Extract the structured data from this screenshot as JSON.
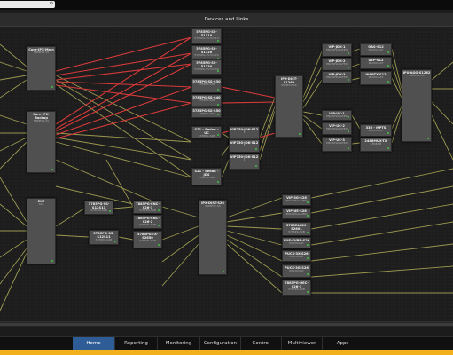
{
  "page_title": "Devices and Links",
  "search": {
    "placeholder": ""
  },
  "colors": {
    "accent": "#2d5c96",
    "link_olive": "#a8a656",
    "link_red": "#d83a3a",
    "status_ok": "#3fbf3f",
    "warning_strip": "#f2b01c"
  },
  "nodes": [
    {
      "id": "core-main",
      "name": "Core-IPX-Main",
      "sub": "SNMPV2-SS"
    },
    {
      "id": "core-backup",
      "name": "Core-IPX-Backup",
      "sub": "SNMPV2-SS"
    },
    {
      "id": "exe",
      "name": "EXE",
      "sub": "S26"
    },
    {
      "id": "s7a",
      "name": "5785PG-SS-51310",
      "sub": "5785PG-SS-51310"
    },
    {
      "id": "s7b",
      "name": "5785PG-SS-51320",
      "sub": "5785PG-SS-51320"
    },
    {
      "id": "s7c",
      "name": "5785PG-SS-51330",
      "sub": "5785PG-SS-51330"
    },
    {
      "id": "s7d",
      "name": "5785PG-SS-S30",
      "sub": "5785PG-S30"
    },
    {
      "id": "s7e",
      "name": "5785PG-SS-S40",
      "sub": "5785PG-S40"
    },
    {
      "id": "s7f",
      "name": "5785PG-SS-S50",
      "sub": "5785PG-S50"
    },
    {
      "id": "s21",
      "name": "S21 - Sedan - UC",
      "sub": "5785PG-S2B"
    },
    {
      "id": "s21b",
      "name": "S21 - Sedan - JDS",
      "sub": "5785PG-S2B"
    },
    {
      "id": "vf1",
      "name": "VIP750-JDK-S12",
      "sub": "3"
    },
    {
      "id": "vf2",
      "name": "VIP750-JDK-S12",
      "sub": "2"
    },
    {
      "id": "vf3",
      "name": "VIP750-JDK-S12",
      "sub": "1"
    },
    {
      "id": "ipx-dist1",
      "name": "IPX-DIST-S1262",
      "sub": "SNMPV2-SS"
    },
    {
      "id": "vjdk1",
      "name": "VIP-JDK-1",
      "sub": "ENCAPSULATED"
    },
    {
      "id": "vjdk2",
      "name": "VIP-JDK-2",
      "sub": "ENCAPSULATED"
    },
    {
      "id": "vjdk3",
      "name": "VIP-JDK-3",
      "sub": "ENCAPSULATED"
    },
    {
      "id": "vuc1",
      "name": "VIP-UC-1",
      "sub": "ENCAPSULATED"
    },
    {
      "id": "vuc2",
      "name": "VIP-UC-2",
      "sub": "ENCAPSULATED"
    },
    {
      "id": "vuc3",
      "name": "VIP-UC-3",
      "sub": "ENCAPSULATED"
    },
    {
      "id": "m1",
      "name": "OAS-S12",
      "sub": "MULTICAST"
    },
    {
      "id": "m2",
      "name": "UEP-S12",
      "sub": "MULTICAST"
    },
    {
      "id": "m3",
      "name": "WAY-TX-S12",
      "sub": "MULTICAST"
    },
    {
      "id": "m4",
      "name": "336 - MPTS",
      "sub": "MULTICAST"
    },
    {
      "id": "m5",
      "name": "2468MUX-TX",
      "sub": "STREAM"
    },
    {
      "id": "ipx-agg",
      "name": "IPX-AGG-S1262",
      "sub": "SNMPV2-SS"
    },
    {
      "id": "r1",
      "name": "5785PG-SS-S12S11",
      "sub": "5785PG-S2B"
    },
    {
      "id": "r2",
      "name": "5785PG-SS-S12S11",
      "sub": "5785PG-S2B"
    },
    {
      "id": "e1",
      "name": "7885PG-ENC-S26-1",
      "sub": "5785PG-S2B"
    },
    {
      "id": "e2",
      "name": "7885PG-ENC-S26-2",
      "sub": "5785PG-S2B"
    },
    {
      "id": "e3",
      "name": "5785PG-TX-S2650",
      "sub": "5785PG-S2B"
    },
    {
      "id": "ipx-dist2",
      "name": "IPX-DIST-S26",
      "sub": "SNMPV2-SS"
    },
    {
      "id": "c1",
      "name": "VIP-3G-S26",
      "sub": "ENCAPSULATED"
    },
    {
      "id": "c2",
      "name": "VIP-UE-S26",
      "sub": "ENCAPSULATED"
    },
    {
      "id": "c3",
      "name": "5785RLINX-S2601",
      "sub": "5785PG-S2B"
    },
    {
      "id": "c4",
      "name": "VUE-EVBR-S26",
      "sub": "MULTICAST"
    },
    {
      "id": "c5",
      "name": "PUCK-3X-S26",
      "sub": "MULTICAST"
    },
    {
      "id": "c6",
      "name": "PUCK-3G-S26",
      "sub": "MULTICAST"
    },
    {
      "id": "c7",
      "name": "7885PG-DEC-S26-1",
      "sub": "5785PG-S2B"
    }
  ],
  "tabs": [
    {
      "label": "Home",
      "active": true
    },
    {
      "label": "Reporting",
      "active": false
    },
    {
      "label": "Monitoring",
      "active": false
    },
    {
      "label": "Configuration",
      "active": false
    },
    {
      "label": "Control",
      "active": false
    },
    {
      "label": "Multiviewer",
      "active": false
    },
    {
      "label": "Apps",
      "active": false
    }
  ]
}
